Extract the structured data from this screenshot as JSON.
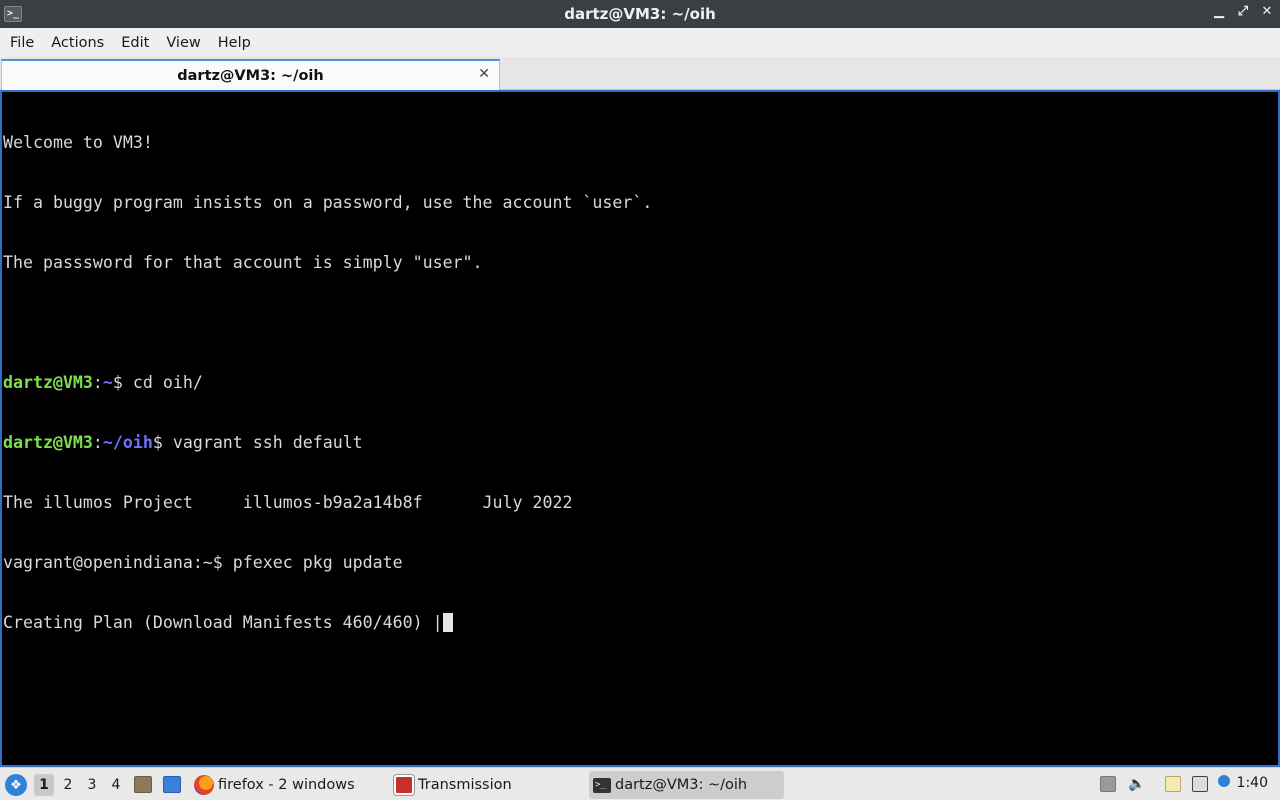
{
  "window": {
    "title": "dartz@VM3: ~/oih",
    "controls": {
      "minimize": "▁",
      "restore": "⤢",
      "close": "✕"
    }
  },
  "menu": [
    "File",
    "Actions",
    "Edit",
    "View",
    "Help"
  ],
  "tab": {
    "label": "dartz@VM3: ~/oih",
    "close": "✕"
  },
  "terminal": {
    "line1": "Welcome to VM3!",
    "line2": "If a buggy program insists on a password, use the account `user`.",
    "line3": "The passsword for that account is simply \"user\".",
    "prompt1": {
      "user": "dartz@VM3",
      "sep": ":",
      "path": "~",
      "dollar": "$ ",
      "cmd": "cd oih/"
    },
    "prompt2": {
      "user": "dartz@VM3",
      "sep": ":",
      "path": "~/oih",
      "dollar": "$ ",
      "cmd": "vagrant ssh default"
    },
    "line6": "The illumos Project     illumos-b9a2a14b8f      July 2022",
    "line7": "vagrant@openindiana:~$ pfexec pkg update",
    "line8": "Creating Plan (Download Manifests 460/460) |"
  },
  "taskbar": {
    "desktops": [
      "1",
      "2",
      "3",
      "4"
    ],
    "tasks": {
      "firefox": "firefox - 2 windows",
      "transmission": "Transmission",
      "terminal": "dartz@VM3: ~/oih"
    },
    "clock": "1:40"
  },
  "colors": {
    "username": "#7fe04d",
    "path": "#6b73ff",
    "accent": "#2f6ec4"
  }
}
